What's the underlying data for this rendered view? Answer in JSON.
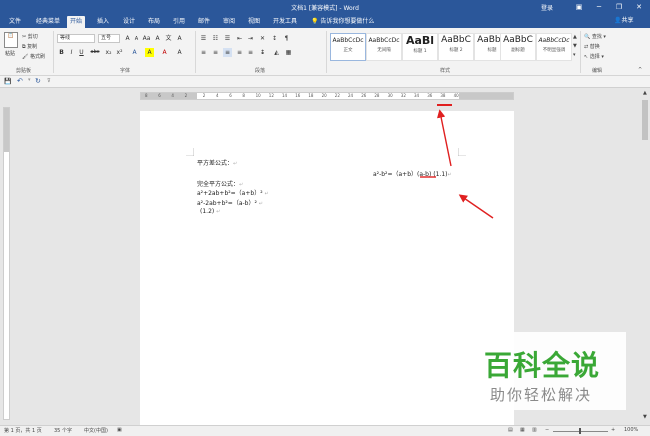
{
  "window": {
    "title": "文档1 [兼容模式] - Word",
    "login_label": "登录",
    "minimize_glyph": "─",
    "restore_glyph": "❐",
    "close_glyph": "✕"
  },
  "tabs": {
    "file": "文件",
    "classic": "经典菜单",
    "home": "开始",
    "insert": "插入",
    "design": "设计",
    "layout": "布局",
    "references": "引用",
    "mailings": "邮件",
    "review": "审阅",
    "view": "视图",
    "developer": "开发工具",
    "tell_me": "告诉我你想要做什么",
    "share": "共享"
  },
  "ribbon": {
    "clipboard": {
      "paste": "粘贴",
      "cut": "剪切",
      "copy": "复制",
      "format_painter": "格式刷",
      "label": "剪贴板"
    },
    "font": {
      "family": "等线",
      "size": "五号",
      "bold": "B",
      "italic": "I",
      "underline": "U",
      "strike": "abc",
      "subscript": "x₂",
      "superscript": "x²",
      "grow": "A",
      "shrink": "A",
      "font_color": "A",
      "highlight": "A",
      "label": "字体"
    },
    "paragraph": {
      "label": "段落"
    },
    "styles": {
      "items": [
        {
          "preview": "AaBbCcDc",
          "name": "正文"
        },
        {
          "preview": "AaBbCcDc",
          "name": "无间隔"
        },
        {
          "preview": "AaBl",
          "name": "标题 1"
        },
        {
          "preview": "AaBbC",
          "name": "标题 2"
        },
        {
          "preview": "AaBbC",
          "name": "标题"
        },
        {
          "preview": "AaBbC",
          "name": "副标题"
        },
        {
          "preview": "AaBbCcDc",
          "name": "不明显强调"
        }
      ],
      "label": "样式"
    },
    "editing": {
      "find": "查找",
      "replace": "替换",
      "select": "选择",
      "label": "编辑"
    }
  },
  "ruler": {
    "numbers": [
      "8",
      "6",
      "4",
      "2",
      "2",
      "4",
      "6",
      "8",
      "10",
      "12",
      "14",
      "16",
      "18",
      "20",
      "22",
      "24",
      "26",
      "28",
      "30",
      "32",
      "34",
      "36",
      "38",
      "40"
    ]
  },
  "document": {
    "square_diff_title": "平方差公式：",
    "square_diff_formula": "a²-b²=（a+b）(a-b)",
    "square_diff_label": "(1.1)",
    "perfect_square_title": "完全平方公式：",
    "perfect_square_line1": "a²+2ab+b²=（a+b）²",
    "perfect_square_line2": "a²-2ab+b²=（a-b）²",
    "perfect_square_label": "(1.2)"
  },
  "status": {
    "page": "第 1 页，共 1 页",
    "words": "35 个字",
    "language": "中文(中国)",
    "zoom": "100%"
  },
  "watermark": {
    "big": "百科全说",
    "small": "助你轻松解决"
  },
  "colors": {
    "title_bar": "#2b579a",
    "annotation": "#e02020",
    "watermark_green": "#3aa836"
  }
}
